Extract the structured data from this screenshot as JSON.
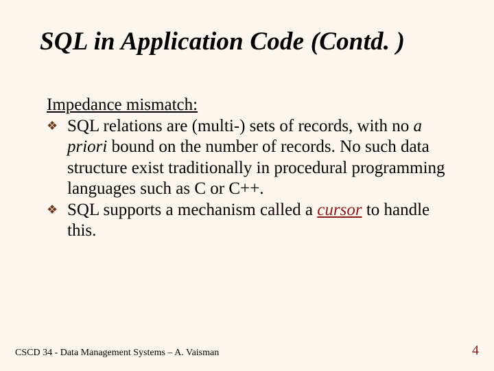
{
  "title": "SQL in Application Code (Contd. )",
  "subheading": "Impedance mismatch:",
  "bullets": [
    {
      "pre": "SQL relations are (multi-) sets of records, with no ",
      "em": "a priori",
      "post": " bound on the number of records.  No such data structure exist traditionally in procedural programming languages such as C or C++."
    },
    {
      "pre": "SQL supports a mechanism called a ",
      "em": "cursor",
      "post": " to handle this."
    }
  ],
  "footer": "CSCD 34 - Data Management Systems – A. Vaisman",
  "pagenum": "4",
  "marker": "❖"
}
